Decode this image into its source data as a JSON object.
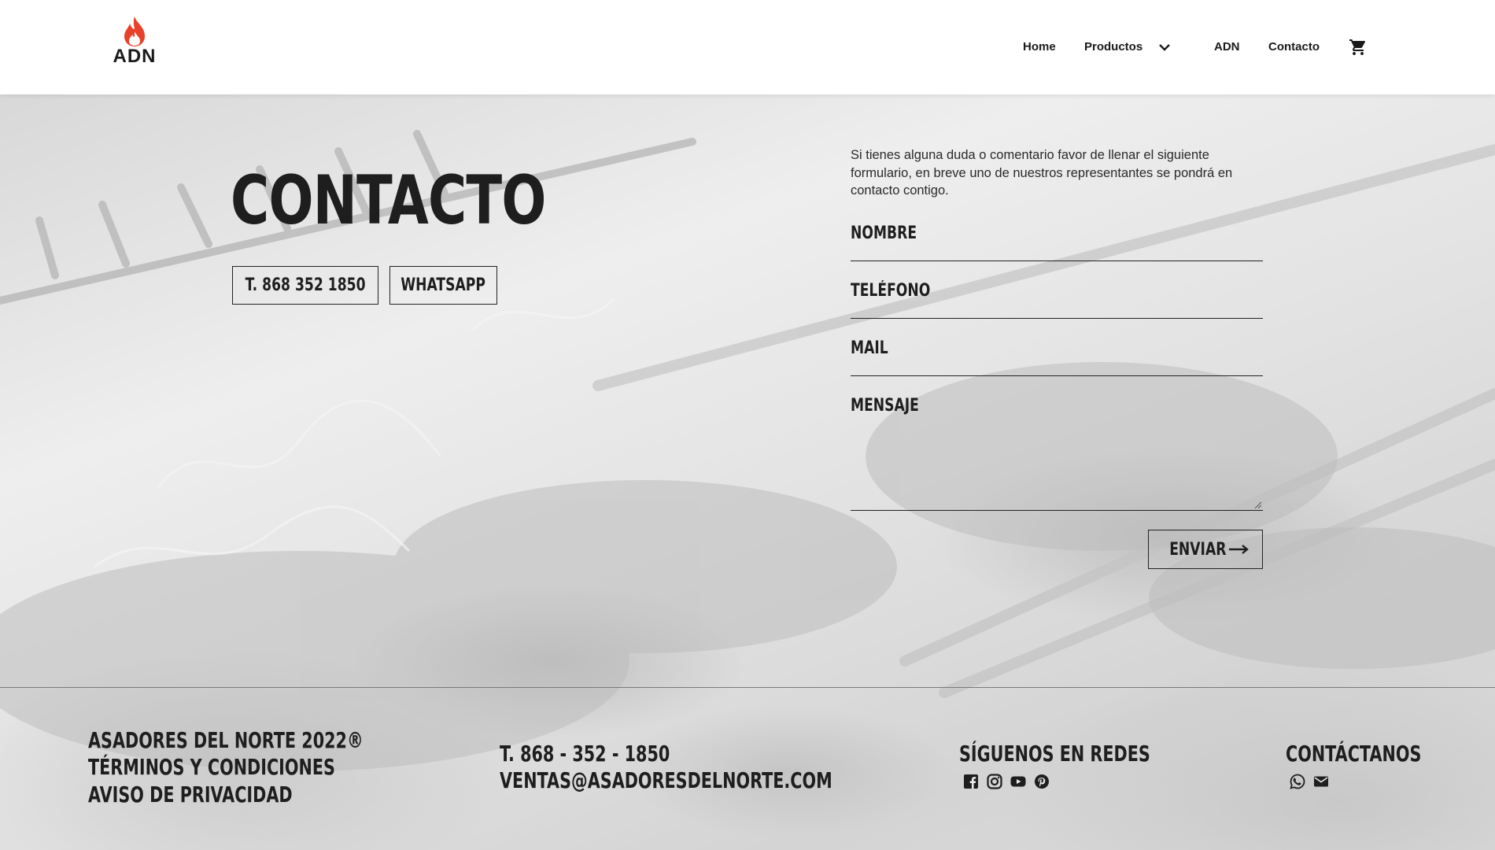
{
  "header": {
    "logo_text": "ADN",
    "nav": {
      "home": "Home",
      "products": "Productos",
      "adn": "ADN",
      "contact": "Contacto"
    }
  },
  "contact": {
    "title": "CONTACTO",
    "phone_button": "T. 868 352 1850",
    "whatsapp_button": "WHATSAPP"
  },
  "form": {
    "intro": "Si tienes alguna duda o comentario favor de llenar el siguiente formulario, en breve uno de nuestros representantes se pondrá en contacto contigo.",
    "name_label": "NOMBRE",
    "phone_label": "TELÉFONO",
    "mail_label": "MAIL",
    "message_label": "MENSAJE",
    "submit": "ENVIAR"
  },
  "footer": {
    "company": "ASADORES DEL NORTE 2022®",
    "terms": "TÉRMINOS Y CONDICIONES",
    "privacy": "AVISO DE PRIVACIDAD",
    "phone": "T. 868 - 352 - 1850",
    "email": "VENTAS@ASADORESDELNORTE.COM",
    "social_title": "SÍGUENOS EN REDES",
    "contact_title": "CONTÁCTANOS",
    "social_icons": [
      "facebook-icon",
      "instagram-icon",
      "youtube-icon",
      "pinterest-icon"
    ],
    "contact_icons": [
      "whatsapp-icon",
      "mail-icon"
    ]
  },
  "colors": {
    "flame_red": "#e8412c",
    "flame_orange": "#f26b3a",
    "text_dark": "#1e1e1e",
    "header_bg": "#ffffff"
  }
}
